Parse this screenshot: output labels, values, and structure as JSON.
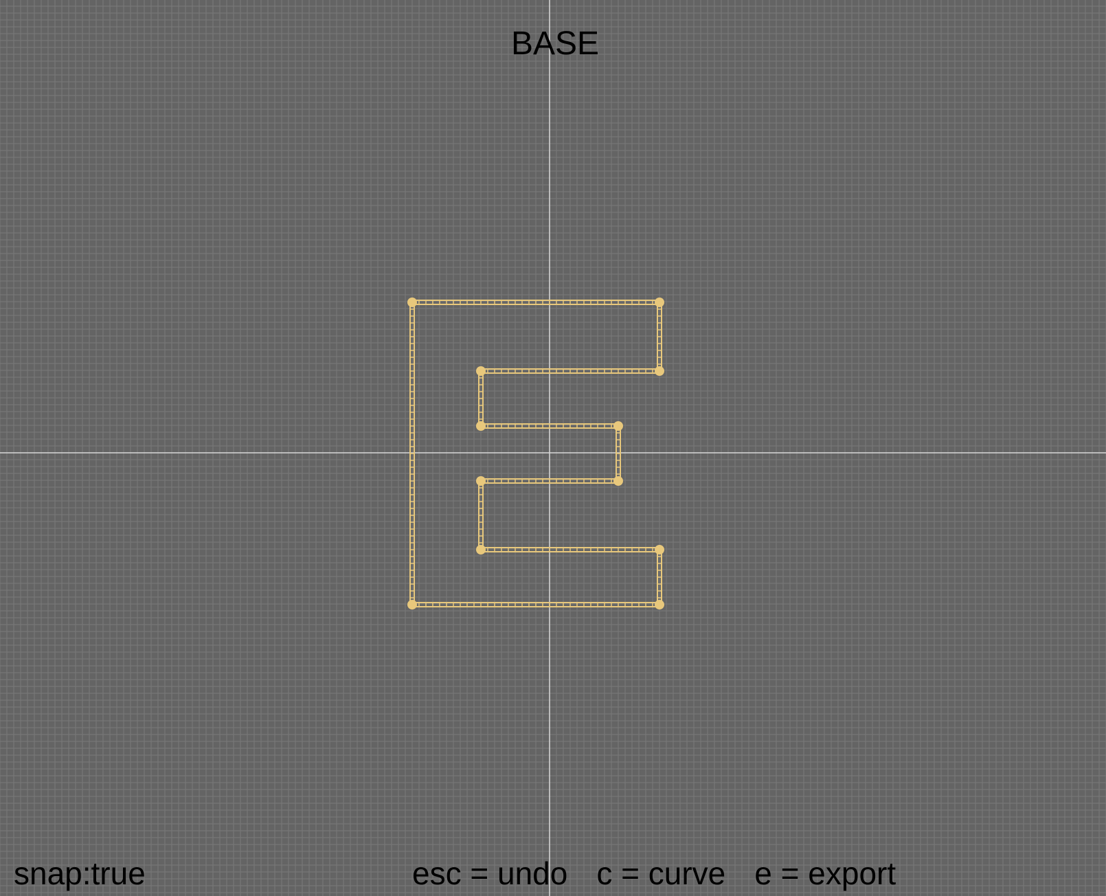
{
  "mode_title": "BASE",
  "snap_status": "snap:true",
  "shortcuts": [
    {
      "key": "esc",
      "action": "undo",
      "label": "esc = undo"
    },
    {
      "key": "c",
      "action": "curve",
      "label": "c = curve"
    },
    {
      "key": "e",
      "action": "export",
      "label": "e = export"
    }
  ],
  "colors": {
    "background": "#646464",
    "grid_line": "#7a7a7a",
    "axis_line": "#d8d8d8",
    "shape_stroke": "#e8c87c",
    "text": "#000000"
  }
}
